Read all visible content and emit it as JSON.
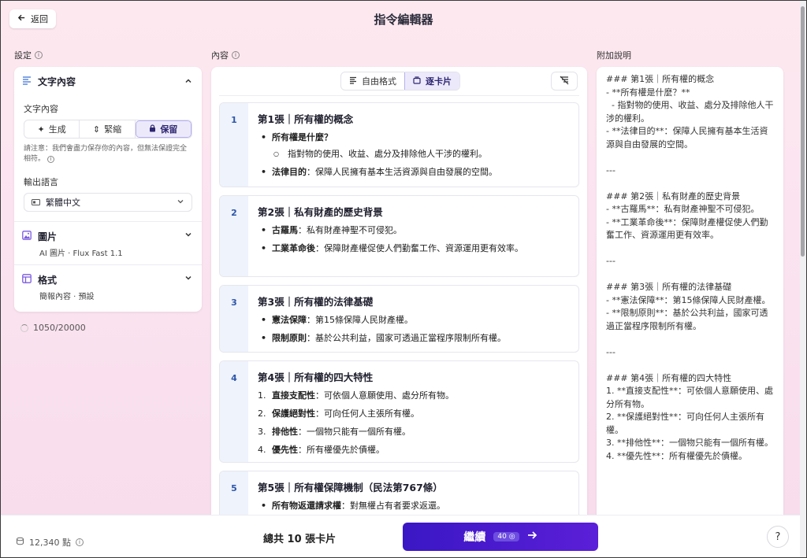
{
  "header": {
    "back_label": "返回",
    "title": "指令編輯器"
  },
  "settings": {
    "label": "設定",
    "text_content": {
      "title": "文字內容",
      "sub_label": "文字內容",
      "modes": [
        "生成",
        "緊縮",
        "保留"
      ],
      "active_mode": "保留",
      "notice": "請注意：我們會盡力保存你的內容，但無法保證完全相符。",
      "language_label": "輸出語言",
      "language_value": "繁體中文"
    },
    "image": {
      "title": "圖片",
      "sub": "AI 圖片 · Flux Fast 1.1"
    },
    "format": {
      "title": "格式",
      "sub": "簡報內容 · 預設"
    },
    "char_count": "1050/20000"
  },
  "content": {
    "label": "內容",
    "tabs": [
      "自由格式",
      "逐卡片"
    ],
    "active_tab": "逐卡片",
    "slides": [
      {
        "num": "1",
        "title": "第1張｜所有權的概念",
        "bullets": [
          {
            "bold": "所有權是什麼？",
            "text": ""
          },
          {
            "sub": true,
            "text": "指對物的使用、收益、處分及排除他人干涉的權利。"
          },
          {
            "bold": "法律目的",
            "text": "：保障人民擁有基本生活資源與自由發展的空間。"
          }
        ]
      },
      {
        "num": "2",
        "title": "第2張｜私有財產的歷史背景",
        "bullets": [
          {
            "bold": "古羅馬",
            "text": "：私有財產神聖不可侵犯。"
          },
          {
            "bold": "工業革命後",
            "text": "：保障財產權促使人們勤奮工作、資源運用更有效率。"
          }
        ]
      },
      {
        "num": "3",
        "title": "第3張｜所有權的法律基礎",
        "bullets": [
          {
            "bold": "憲法保障",
            "text": "：第15條保障人民財產權。"
          },
          {
            "bold": "限制原則",
            "text": "：基於公共利益，國家可透過正當程序限制所有權。"
          }
        ]
      },
      {
        "num": "4",
        "title": "第4張｜所有權的四大特性",
        "bullets": [
          {
            "n": "1.",
            "bold": "直接支配性",
            "text": "：可依個人意願使用、處分所有物。"
          },
          {
            "n": "2.",
            "bold": "保護絕對性",
            "text": "：可向任何人主張所有權。"
          },
          {
            "n": "3.",
            "bold": "排他性",
            "text": "：一個物只能有一個所有權。"
          },
          {
            "n": "4.",
            "bold": "優先性",
            "text": "：所有權優先於債權。"
          }
        ]
      },
      {
        "num": "5",
        "title": "第5張｜所有權保障機制（民法第767條）",
        "bullets": [
          {
            "bold": "所有物返還請求權",
            "text": "：對無權占有者要求返還。"
          }
        ]
      }
    ]
  },
  "notes": {
    "label": "附加說明",
    "text": "### 第1張｜所有權的概念\n- **所有權是什麼？**\n  - 指對物的使用、收益、處分及排除他人干涉的權利。\n- **法律目的**：保障人民擁有基本生活資源與自由發展的空間。\n\n---\n\n### 第2張｜私有財產的歷史背景\n- **古羅馬**：私有財產神聖不可侵犯。\n- **工業革命後**：保障財產權促使人們勤奮工作、資源運用更有效率。\n\n---\n\n### 第3張｜所有權的法律基礎\n- **憲法保障**：第15條保障人民財產權。\n- **限制原則**：基於公共利益，國家可透過正當程序限制所有權。\n\n---\n\n### 第4張｜所有權的四大特性\n1. **直接支配性**：可依個人意願使用、處分所有物。\n2. **保護絕對性**：可向任何人主張所有權。\n3. **排他性**：一個物只能有一個所有權。\n4. **優先性**：所有權優先於債權。"
  },
  "footer": {
    "points": "12,340 點",
    "total": "總共 10 張卡片",
    "continue_label": "繼續",
    "cost": "40",
    "help": "?"
  }
}
